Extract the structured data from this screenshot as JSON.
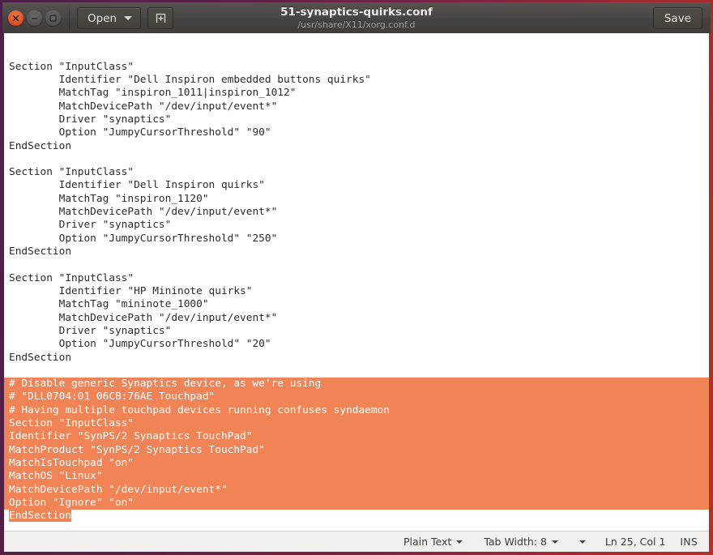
{
  "window": {
    "title": "51-synaptics-quirks.conf",
    "subtitle": "/usr/share/X11/xorg.conf.d",
    "close_label": "Close",
    "minimize_label": "Minimize",
    "maximize_label": "Maximize"
  },
  "toolbar": {
    "open_label": "Open",
    "new_document_label": "",
    "save_label": "Save"
  },
  "editor": {
    "lines": [
      "Section \"InputClass\"",
      "        Identifier \"Dell Inspiron embedded buttons quirks\"",
      "        MatchTag \"inspiron_1011|inspiron_1012\"",
      "        MatchDevicePath \"/dev/input/event*\"",
      "        Driver \"synaptics\"",
      "        Option \"JumpyCursorThreshold\" \"90\"",
      "EndSection",
      "",
      "Section \"InputClass\"",
      "        Identifier \"Dell Inspiron quirks\"",
      "        MatchTag \"inspiron_1120\"",
      "        MatchDevicePath \"/dev/input/event*\"",
      "        Driver \"synaptics\"",
      "        Option \"JumpyCursorThreshold\" \"250\"",
      "EndSection",
      "",
      "Section \"InputClass\"",
      "        Identifier \"HP Mininote quirks\"",
      "        MatchTag \"mininote_1000\"",
      "        MatchDevicePath \"/dev/input/event*\"",
      "        Driver \"synaptics\"",
      "        Option \"JumpyCursorThreshold\" \"20\"",
      "EndSection",
      ""
    ],
    "selected_lines": [
      "# Disable generic Synaptics device, as we're using",
      "# \"DLL0704:01 06CB:76AE Touchpad\"",
      "# Having multiple touchpad devices running confuses syndaemon",
      "Section \"InputClass\"",
      "Identifier \"SynPS/2 Synaptics TouchPad\"",
      "MatchProduct \"SynPS/2 Synaptics TouchPad\"",
      "MatchIsTouchpad \"on\"",
      "MatchOS \"Linux\"",
      "MatchDevicePath \"/dev/input/event*\"",
      "Option \"Ignore\" \"on\""
    ],
    "selected_last_line": "EndSection"
  },
  "statusbar": {
    "language": "Plain Text",
    "tab_width": "Tab Width: 8",
    "position": "Ln 25, Col 1",
    "insert_mode": "INS"
  },
  "colors": {
    "selection_background": "#f08457",
    "selection_text": "#ffffff",
    "editor_background": "#ffffff",
    "editor_text": "#2b2b2b",
    "titlebar": "#4a4643",
    "frame_left": "#4b1f45",
    "frame_right": "#b33127",
    "statusbar_background": "#f2f0ee"
  }
}
